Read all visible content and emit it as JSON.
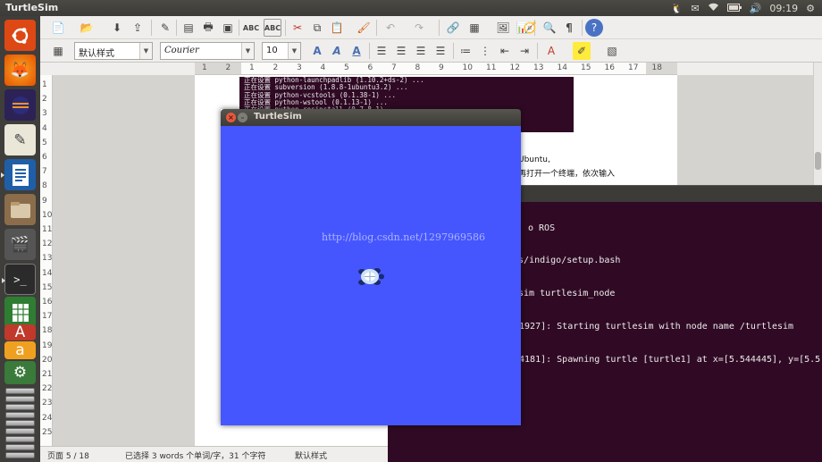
{
  "top_panel": {
    "app_title": "TurtleSim",
    "clock": "09:19"
  },
  "writer": {
    "paragraph_style": "默认样式",
    "font_name": "Courier",
    "font_size": "10",
    "ruler_marks": [
      "1",
      "2",
      "1",
      "2",
      "3",
      "4",
      "5",
      "6",
      "7",
      "8",
      "9",
      "10",
      "11",
      "12",
      "13",
      "14",
      "15",
      "16",
      "17",
      "18"
    ],
    "vruler_marks": [
      "1",
      "2",
      "3",
      "4",
      "5",
      "6",
      "7",
      "8",
      "9",
      "10",
      "11",
      "12",
      "13",
      "14",
      "15",
      "16",
      "17",
      "18",
      "19",
      "20",
      "21",
      "22",
      "23",
      "24",
      "25"
    ],
    "doc_terminal_lines": [
      "正在设置 python-launchpadlib (1.10.2+ds-2) ...",
      "正在设置 subversion (1.8.8-1ubuntu3.2) ...",
      "正在设置 python-vcstools (0.1.38-1) ...",
      "正在设置 python-wstool (0.1.13-1) ...",
      "正在设置 python-rosinstall (0.7.8-1) ..."
    ],
    "doc_text_1": "Ubuntu,",
    "doc_text_2": "再打开一个终端，依次输入",
    "status": {
      "page": "页面 5 / 18",
      "selection": "已选择 3 words 个单词/字，31 个字符",
      "style": "默认样式"
    }
  },
  "terminal": {
    "lines": [
      "o ROS",
      "ros/indigo/setup.bash",
      "esim turtlesim_node",
      "31927]: Starting turtlesim with node name /turtlesim",
      "54181]: Spawning turtle [turtle1] at x=[5.544445], y=[5.5"
    ]
  },
  "turtlesim": {
    "title": "TurtleSim",
    "background_color": "#4556ff"
  },
  "watermark": "http://blog.csdn.net/1297969586",
  "colors": {
    "launcher": "#3f3e3b",
    "terminal_bg": "#300a24",
    "close_button": "#e7583e"
  }
}
